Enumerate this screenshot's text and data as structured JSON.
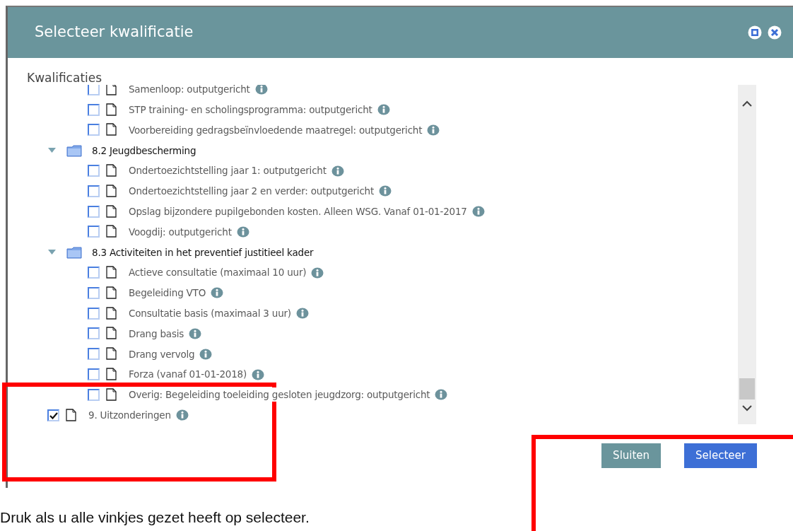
{
  "dialog": {
    "title": "Selecteer kwalificatie",
    "section_label": "Kwalificaties",
    "tree": [
      {
        "kind": "folder",
        "children": [
          {
            "kind": "leaf",
            "label": "Samenloop: outputgericht",
            "checked": false
          },
          {
            "kind": "leaf",
            "label": "STP training- en scholingsprogramma: outputgericht",
            "checked": false
          },
          {
            "kind": "leaf",
            "label": "Voorbereiding gedragsbeïnvloedende maatregel: outputgericht",
            "checked": false
          }
        ]
      },
      {
        "kind": "folder",
        "label": "8.2 Jeugdbescherming",
        "expanded": true,
        "children": [
          {
            "kind": "leaf",
            "label": "Ondertoezichtstelling jaar 1: outputgericht",
            "checked": false
          },
          {
            "kind": "leaf",
            "label": "Ondertoezichtstelling jaar 2 en verder: outputgericht",
            "checked": false
          },
          {
            "kind": "leaf",
            "label": "Opslag bijzondere pupilgebonden kosten. Alleen WSG. Vanaf 01-01-2017",
            "checked": false
          },
          {
            "kind": "leaf",
            "label": "Voogdij: outputgericht",
            "checked": false
          }
        ]
      },
      {
        "kind": "folder",
        "label": "8.3 Activiteiten in het preventief justitieel kader",
        "expanded": true,
        "children": [
          {
            "kind": "leaf",
            "label": "Actieve consultatie (maximaal 10 uur)",
            "checked": false
          },
          {
            "kind": "leaf",
            "label": "Begeleiding VTO",
            "checked": false
          },
          {
            "kind": "leaf",
            "label": "Consultatie basis (maximaal 3 uur)",
            "checked": false
          },
          {
            "kind": "leaf",
            "label": "Drang basis",
            "checked": false
          },
          {
            "kind": "leaf",
            "label": "Drang vervolg",
            "checked": false
          },
          {
            "kind": "leaf",
            "label": "Forza (vanaf 01-01-2018)",
            "checked": false
          },
          {
            "kind": "leaf",
            "label": "Overig: Begeleiding toeleiding gesloten jeugdzorg: outputgericht",
            "checked": false
          }
        ]
      },
      {
        "kind": "leaf",
        "label": "9. Uitzonderingen",
        "checked": true
      }
    ],
    "buttons": [
      {
        "label": "Sluiten",
        "kind": "secondary"
      },
      {
        "label": "Selecteer",
        "kind": "primary"
      }
    ]
  },
  "caption": "Druk als u alle vinkjes gezet heeft op selecteer."
}
